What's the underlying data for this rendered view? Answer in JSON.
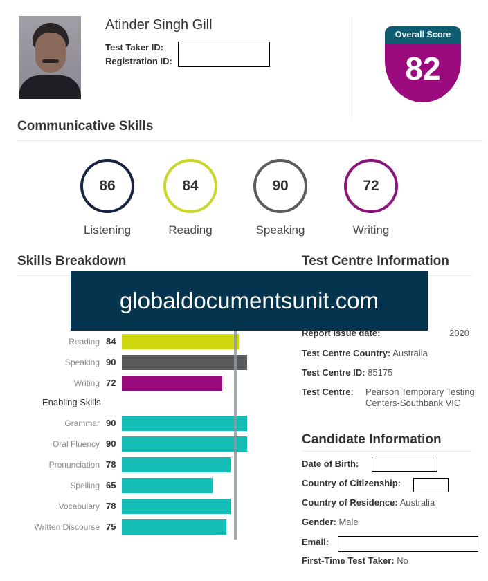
{
  "header": {
    "candidate_name": "Atinder Singh Gill",
    "test_taker_id_label": "Test Taker ID:",
    "test_taker_id_value": "",
    "registration_id_label": "Registration ID:",
    "registration_id_value": ""
  },
  "overall_score": {
    "label": "Overall Score",
    "value": "82",
    "band_color": "#0f5b6f",
    "body_color": "#9b0a7d"
  },
  "communicative_skills": {
    "title": "Communicative Skills",
    "items": [
      {
        "label": "Listening",
        "score": "86",
        "color": "#17233f"
      },
      {
        "label": "Reading",
        "score": "84",
        "color": "#c9d72a"
      },
      {
        "label": "Speaking",
        "score": "90",
        "color": "#5c5c5c"
      },
      {
        "label": "Writing",
        "score": "72",
        "color": "#8b1479"
      }
    ]
  },
  "skills_breakdown": {
    "title": "Skills Breakdown",
    "enabling_title": "Enabling Skills"
  },
  "chart_data": {
    "type": "bar",
    "orientation": "horizontal",
    "title": "Skills Breakdown",
    "reference_line": {
      "label": "Overall Score",
      "value": 82
    },
    "xlim": [
      0,
      90
    ],
    "groups": [
      {
        "name": "Communicative Skills",
        "categories": [
          "Reading",
          "Speaking",
          "Writing"
        ],
        "values": [
          84,
          90,
          72
        ],
        "colors": [
          "#cdd90e",
          "#5b5b5b",
          "#9b0a7d"
        ]
      },
      {
        "name": "Enabling Skills",
        "categories": [
          "Grammar",
          "Oral Fluency",
          "Pronunciation",
          "Spelling",
          "Vocabulary",
          "Written Discourse"
        ],
        "values": [
          90,
          90,
          78,
          65,
          78,
          75
        ],
        "colors": [
          "#13bcb4",
          "#13bcb4",
          "#13bcb4",
          "#13bcb4",
          "#13bcb4",
          "#13bcb4"
        ]
      }
    ],
    "hidden_note": "Listening bar is obscured by watermark banner"
  },
  "test_centre": {
    "title": "Test Centre Information",
    "report_issue_label": "Report Issue date:",
    "report_issue_value": "2020",
    "fields": [
      {
        "label": "Test Centre Country:",
        "value": "Australia"
      },
      {
        "label": "Test Centre ID:",
        "value": "85175"
      },
      {
        "label": "Test Centre:",
        "value": "Pearson Temporary Testing",
        "value2": "Centers-Southbank VIC"
      }
    ]
  },
  "candidate_info": {
    "title": "Candidate Information",
    "dob_label": "Date of Birth:",
    "citizenship_label": "Country of Citizenship:",
    "residence_label": "Country of Residence:",
    "residence_value": "Australia",
    "gender_label": "Gender:",
    "gender_value": "Male",
    "email_label": "Email:",
    "first_time_label": "First-Time Test Taker:",
    "first_time_value": "No"
  },
  "watermark": {
    "text": "globaldocumentsunit.com",
    "color": "#04344e"
  }
}
